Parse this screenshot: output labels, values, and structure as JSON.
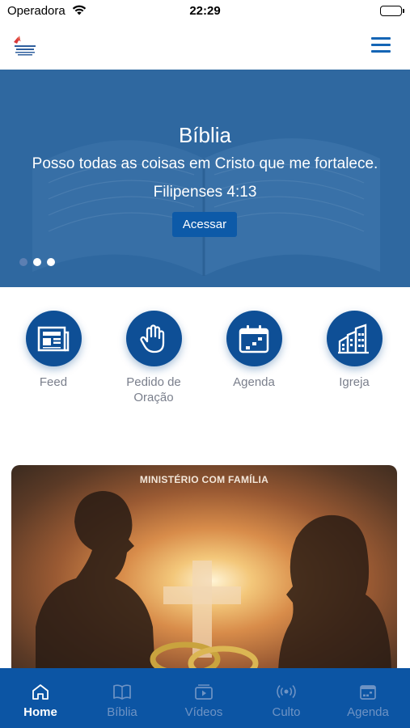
{
  "status_bar": {
    "carrier": "Operadora",
    "time": "22:29"
  },
  "header": {
    "logo_icon": "church-logo",
    "menu_icon": "hamburger-menu-icon"
  },
  "hero": {
    "title": "Bíblia",
    "verse": "Posso todas as coisas em Cristo que me fortalece.",
    "reference": "Filipenses 4:13",
    "button_label": "Acessar",
    "slides_total": 3,
    "active_slide": 1
  },
  "quick_actions": [
    {
      "label": "Feed",
      "icon": "newspaper-icon"
    },
    {
      "label": "Pedido de Oração",
      "icon": "raised-hand-icon"
    },
    {
      "label": "Agenda",
      "icon": "calendar-icon"
    },
    {
      "label": "Igreja",
      "icon": "buildings-icon"
    }
  ],
  "card": {
    "title": "MINISTÉRIO COM FAMÍLIA"
  },
  "tabbar": {
    "items": [
      {
        "label": "Home",
        "icon": "home-icon",
        "active": true
      },
      {
        "label": "Bíblia",
        "icon": "book-icon",
        "active": false
      },
      {
        "label": "Vídeos",
        "icon": "video-icon",
        "active": false
      },
      {
        "label": "Culto",
        "icon": "broadcast-icon",
        "active": false
      },
      {
        "label": "Agenda",
        "icon": "calendar-icon",
        "active": false
      }
    ]
  },
  "colors": {
    "primary": "#0c55a4",
    "icon_circle": "#0e4f96",
    "label_gray": "#7a7f8c"
  }
}
